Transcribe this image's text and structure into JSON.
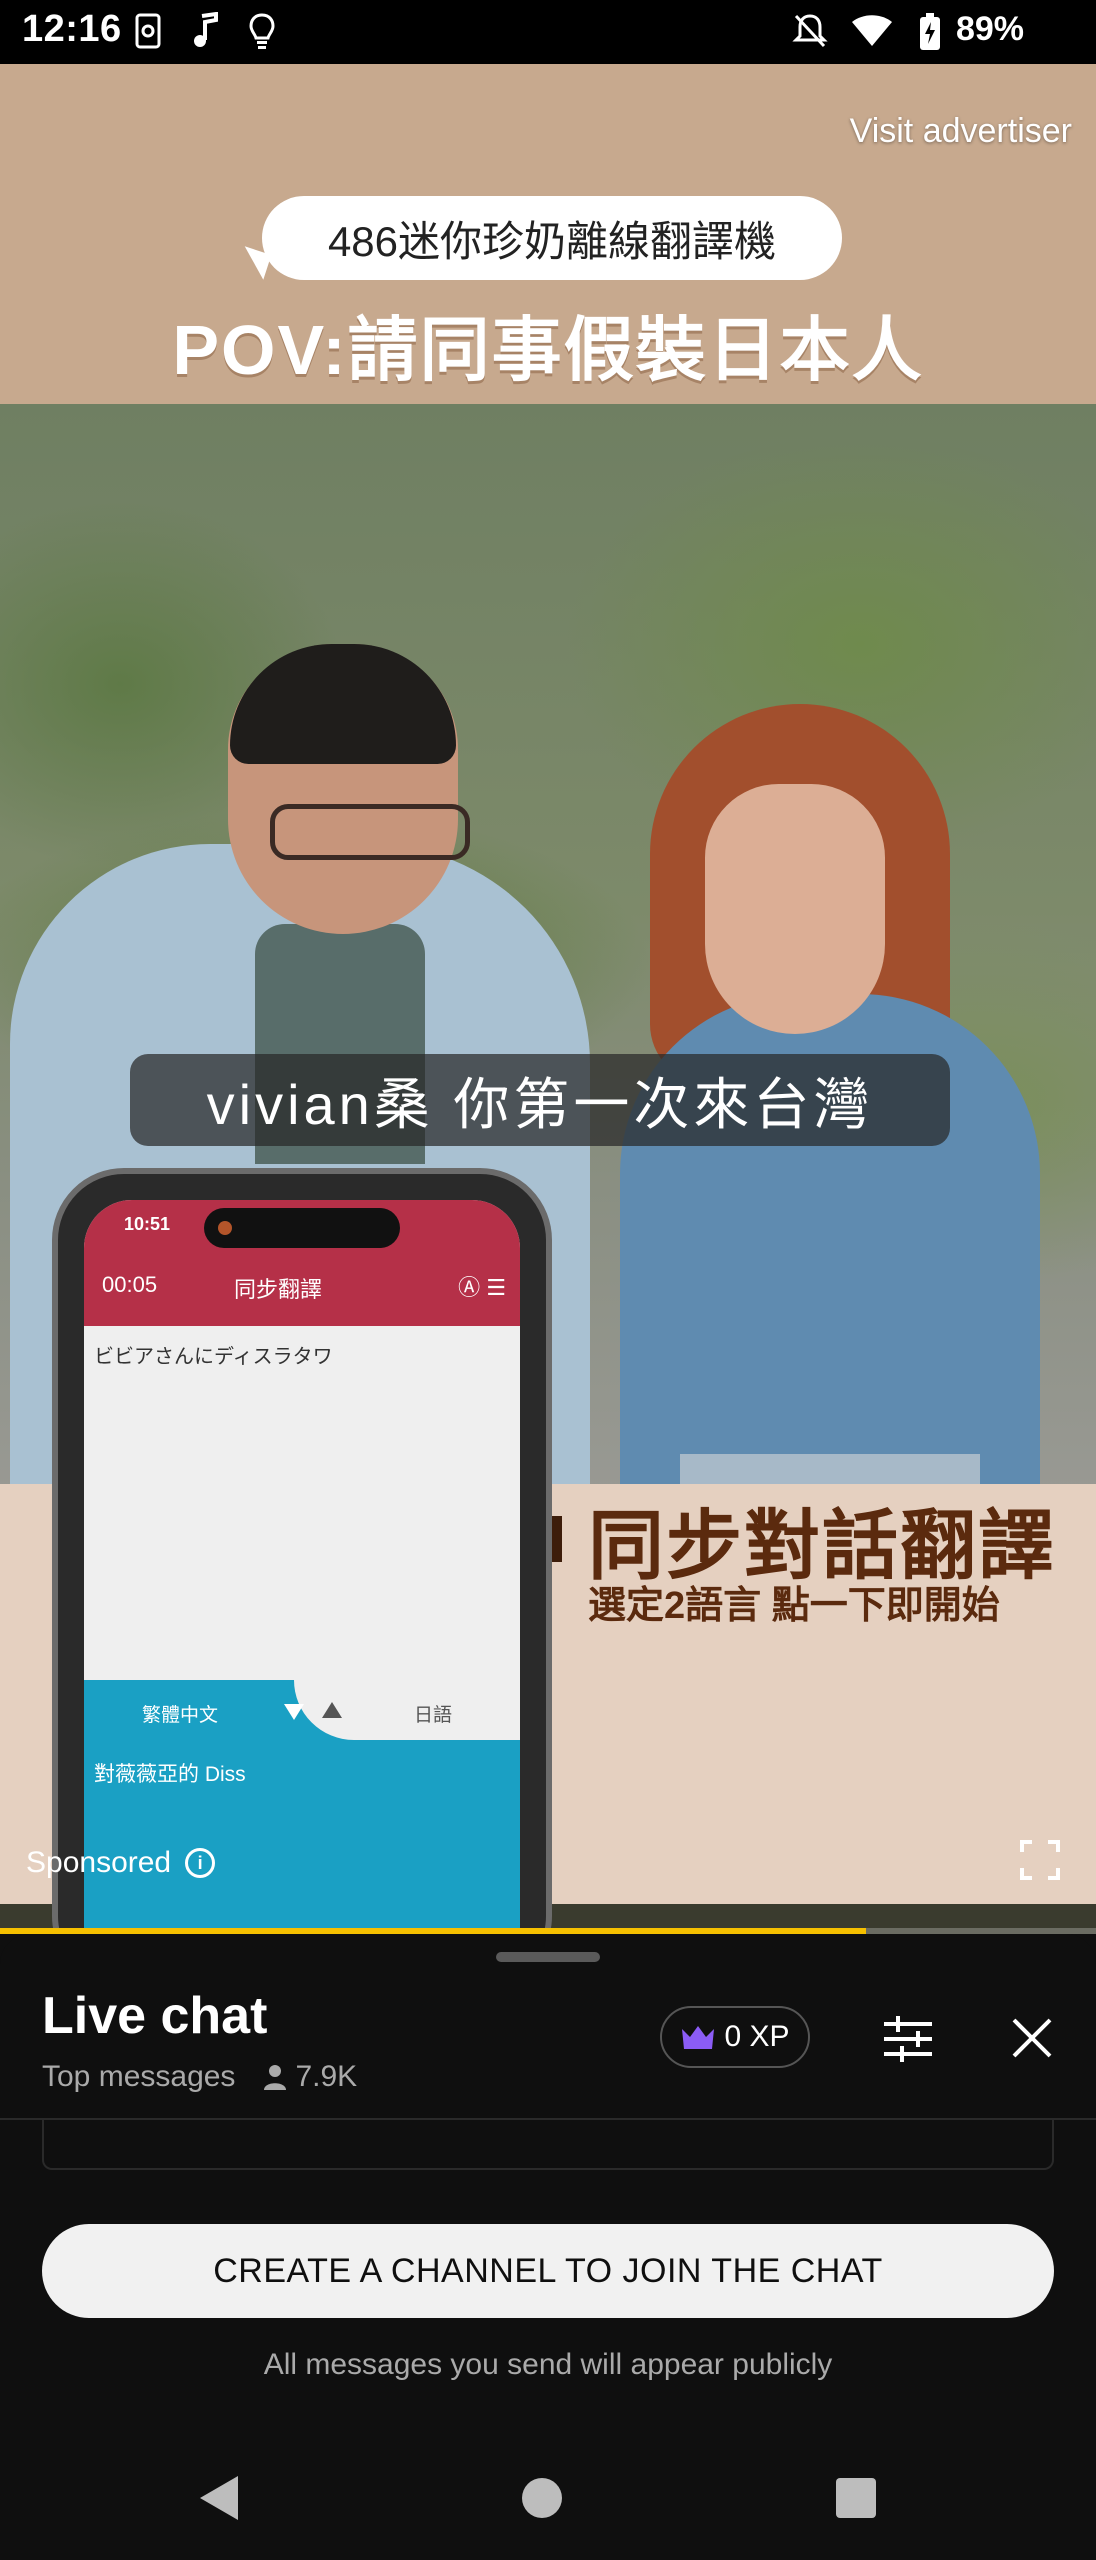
{
  "status_bar": {
    "time": "12:16",
    "battery_percent": "89%",
    "icons": [
      "screen-record-icon",
      "music-note-icon",
      "lightbulb-icon",
      "mute-icon",
      "wifi-icon",
      "battery-charging-icon"
    ]
  },
  "video": {
    "visit_advertiser": "Visit advertiser",
    "bubble_text": "486迷你珍奶離線翻譯機",
    "headline": "POV:請同事假裝日本人",
    "subtitle": "vivian桑  你第一次來台灣",
    "promo_title": "同步對話翻譯",
    "promo_subtitle": "選定2語言 點一下即開始",
    "sponsored": "Sponsored",
    "progress_fraction": 0.79,
    "progress_color": "#f6c000",
    "phone": {
      "time": "10:51",
      "timer": "00:05",
      "title": "同步翻譯",
      "transcript_ja": "ビビアさんにディスラタワ",
      "lang_left": "繁體中文",
      "lang_right": "日語",
      "transcript_zh": "對薇薇亞的 Diss",
      "header_color": "#b53048",
      "accent_color": "#1aa0c4"
    }
  },
  "chat": {
    "title": "Live chat",
    "mode": "Top messages",
    "viewers": "7.9K",
    "xp": "0 XP",
    "create_channel_button": "CREATE A CHANNEL TO JOIN THE CHAT",
    "public_note": "All messages you send will appear publicly"
  }
}
